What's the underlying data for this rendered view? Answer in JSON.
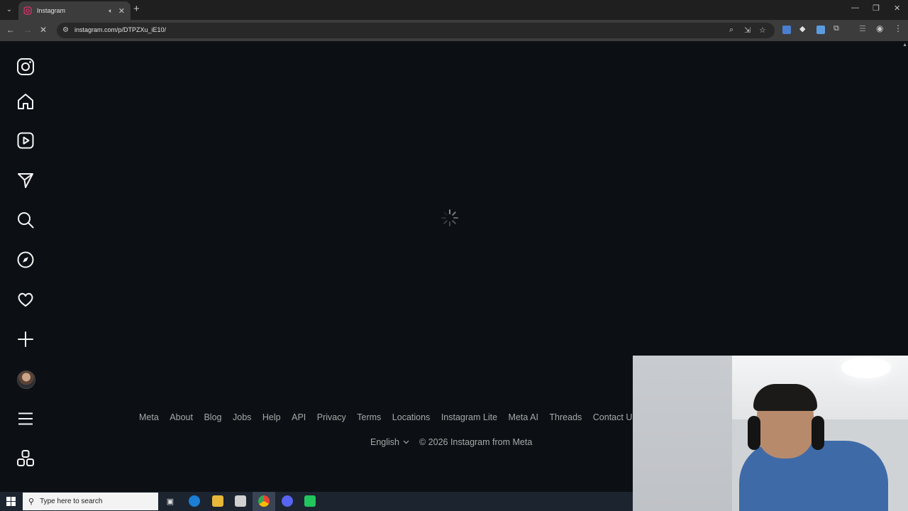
{
  "browser": {
    "tab_title": "Instagram",
    "url": "instagram.com/p/DTPZXu_iE10/"
  },
  "sidebar": {
    "items": [
      {
        "name": "instagram-logo-icon"
      },
      {
        "name": "home-icon"
      },
      {
        "name": "reels-icon"
      },
      {
        "name": "messages-icon"
      },
      {
        "name": "search-icon"
      },
      {
        "name": "explore-icon"
      },
      {
        "name": "notifications-icon"
      },
      {
        "name": "create-icon"
      },
      {
        "name": "profile-avatar"
      },
      {
        "name": "more-menu-icon"
      },
      {
        "name": "also-from-meta-icon"
      }
    ]
  },
  "footer": {
    "links": [
      "Meta",
      "About",
      "Blog",
      "Jobs",
      "Help",
      "API",
      "Privacy",
      "Terms",
      "Locations",
      "Instagram Lite",
      "Meta AI",
      "Threads",
      "Contact Uploading & Non-Users"
    ],
    "language": "English",
    "copyright": "© 2026 Instagram from Meta"
  },
  "taskbar": {
    "search_placeholder": "Type here to search"
  },
  "colors": {
    "page_background": "#0c1014",
    "footer_text": "#a8a8a8",
    "chrome_toolbar": "#3c3c3c"
  }
}
